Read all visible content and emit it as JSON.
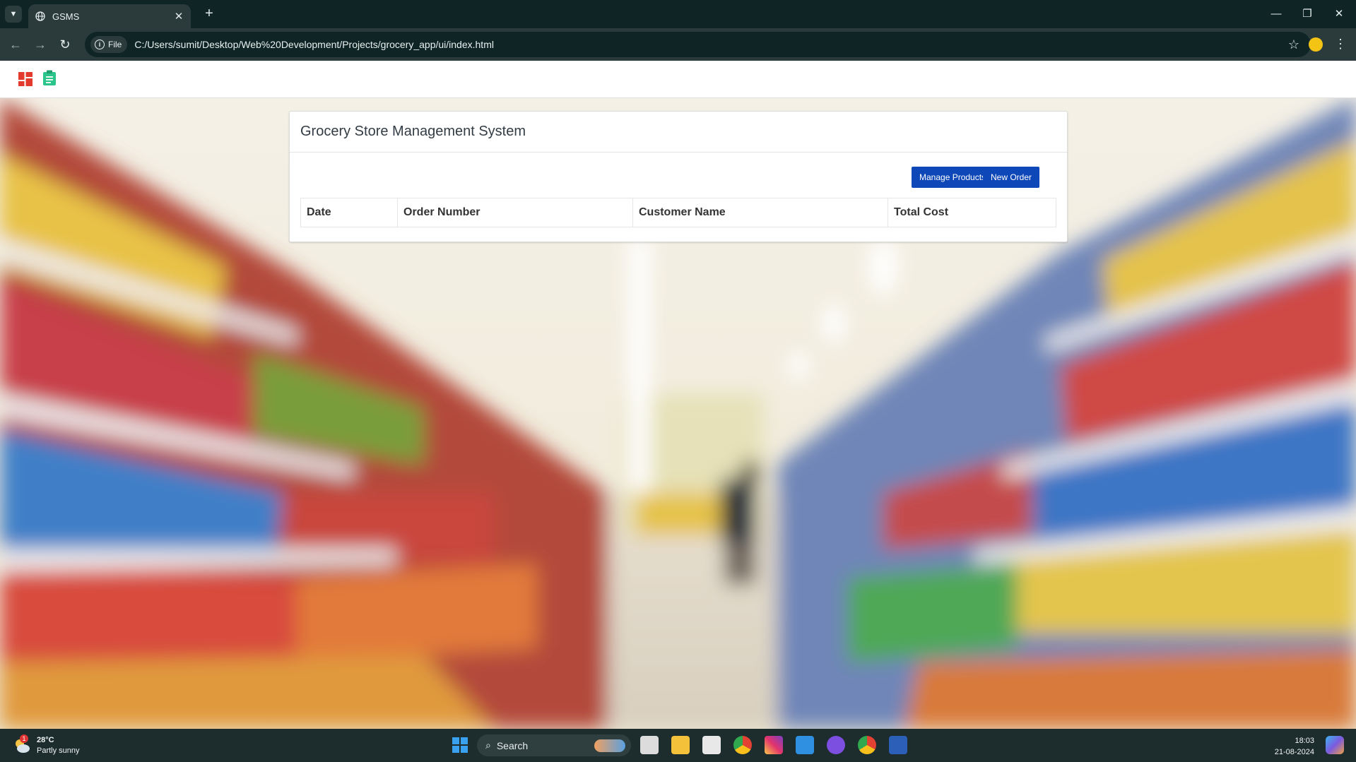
{
  "browser": {
    "tab_title": "GSMS",
    "new_tab_symbol": "+",
    "close_tab_symbol": "✕",
    "address_chip_label": "File",
    "url": "C:/Users/sumit/Desktop/Web%20Development/Projects/grocery_app/ui/index.html",
    "icons": [
      "tab-list-icon",
      "globe-icon",
      "back-icon",
      "forward-icon",
      "reload-icon",
      "info-icon",
      "bookmark-star-icon",
      "profile-icon",
      "menu-icon",
      "minimize-icon",
      "restore-icon",
      "close-window-icon"
    ]
  },
  "app": {
    "nav_icons": [
      "dashboard-icon",
      "orders-clipboard-icon"
    ],
    "brand_colors": {
      "dashboard": "#e23b2e",
      "orders": "#2bc48a"
    },
    "title": "Grocery Store Management System",
    "buttons": {
      "manage_products": "Manage Products",
      "new_order": "New Order"
    },
    "table": {
      "headers": [
        "Date",
        "Order Number",
        "Customer Name",
        "Total Cost"
      ],
      "rows": []
    },
    "accent_color": "#0d47b8",
    "background_description_icon": "grocery-aisle-background-image"
  },
  "taskbar": {
    "weather": {
      "temperature": "28°C",
      "condition": "Partly sunny",
      "badge": "1"
    },
    "search_placeholder": "Search",
    "apps": [
      "start-icon",
      "task-view-icon",
      "file-explorer-icon",
      "microsoft-store-icon",
      "chrome-icon",
      "instagram-icon",
      "vscode-icon",
      "obsidian-icon",
      "chrome-active-icon",
      "word-icon"
    ],
    "time": "18:03",
    "date": "21-08-2024"
  }
}
